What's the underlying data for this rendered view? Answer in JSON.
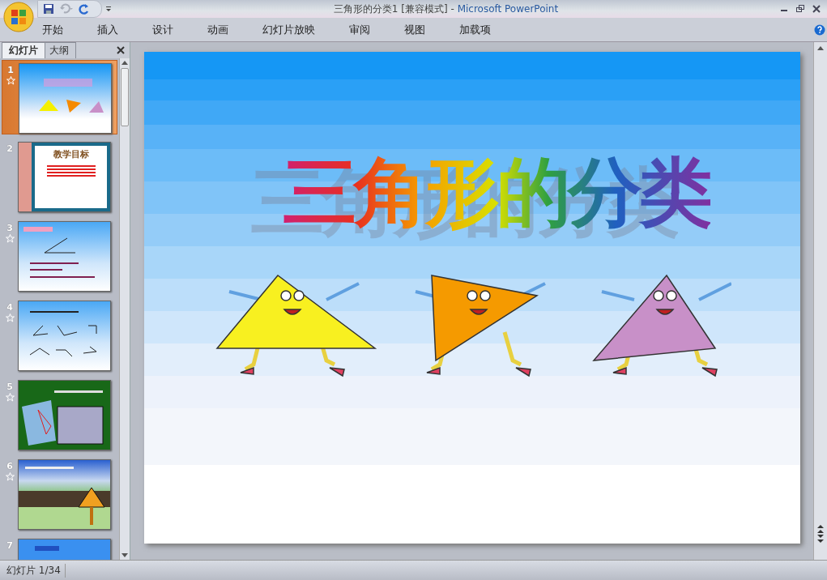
{
  "window": {
    "title": "三角形的分类1 [兼容模式]",
    "separator": "-",
    "app": "Microsoft PowerPoint"
  },
  "ribbon_tabs": [
    {
      "label": "开始"
    },
    {
      "label": "插入"
    },
    {
      "label": "设计"
    },
    {
      "label": "动画"
    },
    {
      "label": "幻灯片放映"
    },
    {
      "label": "审阅"
    },
    {
      "label": "视图"
    },
    {
      "label": "加载项"
    }
  ],
  "panel_tabs": [
    {
      "label": "幻灯片",
      "selected": true
    },
    {
      "label": "大纲",
      "selected": false
    }
  ],
  "slides": [
    {
      "number": "1",
      "selected": true,
      "animated": true,
      "kind": "title"
    },
    {
      "number": "2",
      "selected": false,
      "animated": false,
      "kind": "objectives",
      "title": "教学目标"
    },
    {
      "number": "3",
      "selected": false,
      "animated": true,
      "kind": "angle"
    },
    {
      "number": "4",
      "selected": false,
      "animated": true,
      "kind": "angles"
    },
    {
      "number": "5",
      "selected": false,
      "animated": true,
      "kind": "photos"
    },
    {
      "number": "6",
      "selected": false,
      "animated": true,
      "kind": "sign"
    },
    {
      "number": "7",
      "selected": false,
      "animated": false,
      "kind": "partial"
    }
  ],
  "slide": {
    "title": "三角形的分类"
  },
  "status_bar": {
    "slide_indicator": "幻灯片 1/34"
  }
}
